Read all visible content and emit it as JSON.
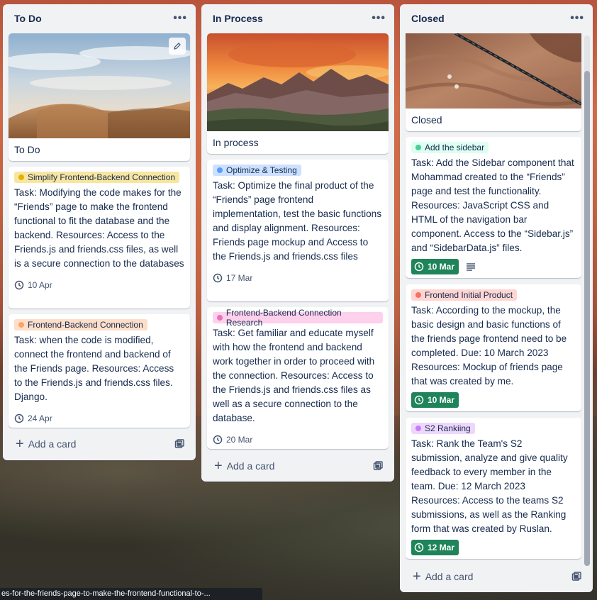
{
  "lists": {
    "todo": {
      "title": "To Do",
      "menu": "•••",
      "cover_title": "To Do",
      "add_card": "Add a card",
      "cards": [
        {
          "label": "Simplify Frontend-Backend Connection",
          "label_bg": "#f8e6a0",
          "label_dot": "#e2b203",
          "text": "Task: Modifying the code makes for the “Friends” page to make the frontend functional to fit the database and the backend. Resources: Access to the Friends.js and friends.css files, as well is a secure connection to the databases",
          "date": "10 Apr"
        },
        {
          "label": "Frontend-Backend Connection",
          "label_bg": "#fedec8",
          "label_dot": "#fea362",
          "text": "Task: when the code is modified, connect the frontend and backend of the Friends page. Resources: Access to the Friends.js and friends.css files. Django.",
          "date": "24 Apr"
        }
      ]
    },
    "inprocess": {
      "title": "In Process",
      "menu": "•••",
      "cover_title": "In process",
      "add_card": "Add a card",
      "cards": [
        {
          "label": "Optimize & Testing",
          "label_bg": "#cce0ff",
          "label_dot": "#579dff",
          "text": "Task: Optimize the final product of the “Friends” page frontend implementation, test the basic functions and display alignment. Resources: Friends page mockup and Access to the Friends.js and friends.css files",
          "date": "17 Mar"
        },
        {
          "label": "Frontend-Backend Connection Research",
          "label_bg": "#fdd0ec",
          "label_dot": "#e774bb",
          "text": "Task: Get familiar and educate myself with how the frontend and backend work together in order to proceed with the connection. Resources: Access to the Friends.js and friends.css files as well as a secure connection to the database.",
          "date": "20 Mar"
        }
      ]
    },
    "closed": {
      "title": "Closed",
      "menu": "•••",
      "cover_title": "Closed",
      "add_card": "Add a card",
      "cards": [
        {
          "label": "Add the sidebar",
          "label_bg": "#dcfff1",
          "label_dot": "#4bce97",
          "text": "Task: Add the Sidebar component that Mohammad created to the “Friends” page and test the functionality. Resources: JavaScript CSS and HTML of the navigation bar component. Access to the “Sidebar.js” and “SidebarData.js” files.",
          "date": "10 Mar"
        },
        {
          "label": "Frontend Initial Product",
          "label_bg": "#ffd5d2",
          "label_dot": "#f87168",
          "text": "Task: According to the mockup, the basic design and basic functions of the friends page frontend need to be completed. Due: 10 March 2023 Resources: Mockup of friends page that was created by me.",
          "date": "10 Mar"
        },
        {
          "label": "S2 Rankiing",
          "label_bg": "#eed7fc",
          "label_dot": "#c97cf4",
          "text": "Task: Rank the Team's S2 submission, analyze and give quality feedback to every member in the team. Due: 12 March 2023 Resources: Access to the teams S2 submissions, as well as the Ranking form that was created by Ruslan.",
          "date": "12 Mar"
        }
      ]
    }
  },
  "status_url": "es-for-the-friends-page-to-make-the-frontend-functional-to-..."
}
